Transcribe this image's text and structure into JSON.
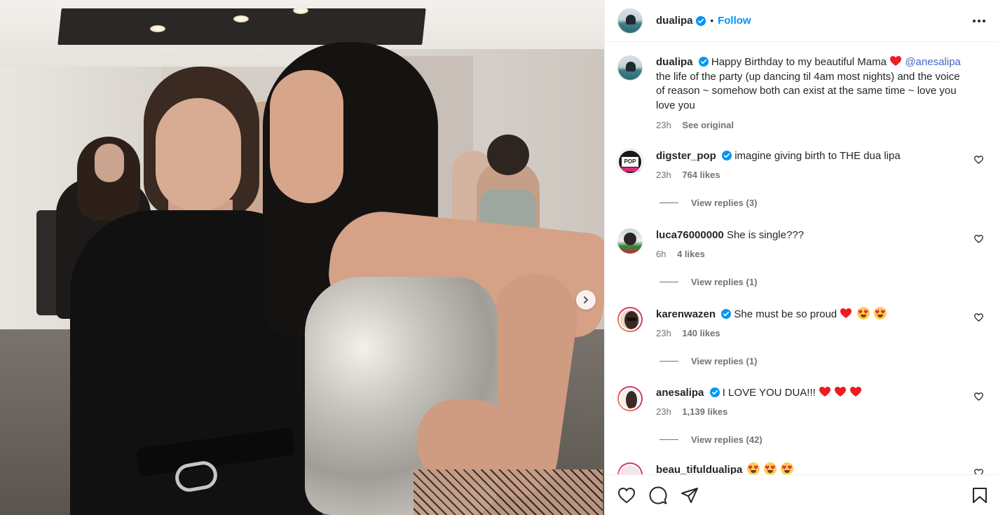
{
  "post": {
    "username": "dualipa",
    "verified": true,
    "separator": "•",
    "follow_label": "Follow",
    "more_icon": "more-horizontal-icon"
  },
  "caption": {
    "username": "dualipa",
    "text_before_heart": "Happy Birthday to my beautiful Mama",
    "mention": "@anesalipa",
    "text_after": "the life of the party (up dancing til 4am most nights) and the voice of reason ~ somehow both can exist at the same time ~ love you love you",
    "time": "23h",
    "see_original": "See original"
  },
  "comments": [
    {
      "username": "digster_pop",
      "verified": true,
      "text": "imagine giving birth to THE dua lipa",
      "time": "23h",
      "likes": "764 likes",
      "replies": "View replies (3)",
      "avatar_text": "DIGSTER POP"
    },
    {
      "username": "luca76000000",
      "verified": false,
      "text": "She is single???",
      "time": "6h",
      "likes": "4 likes",
      "replies": "View replies (1)"
    },
    {
      "username": "karenwazen",
      "verified": true,
      "text": "She must be so proud",
      "time": "23h",
      "likes": "140 likes",
      "replies": "View replies (1)"
    },
    {
      "username": "anesalipa",
      "verified": true,
      "text": "I LOVE YOU DUA!!!",
      "time": "23h",
      "likes": "1,139 likes",
      "replies": "View replies (42)"
    },
    {
      "username": "beau_tifuldualipa",
      "verified": false,
      "text": ""
    }
  ],
  "colors": {
    "link_blue": "#0095f6",
    "mention_blue": "#4763c9",
    "verified_blue": "#0095f6",
    "heart_red": "#ed1c24",
    "meta_gray": "#737373"
  },
  "icons": {
    "next": "chevron-right-icon",
    "like": "heart-icon",
    "comment": "comment-icon",
    "share": "send-icon",
    "save": "bookmark-icon"
  }
}
